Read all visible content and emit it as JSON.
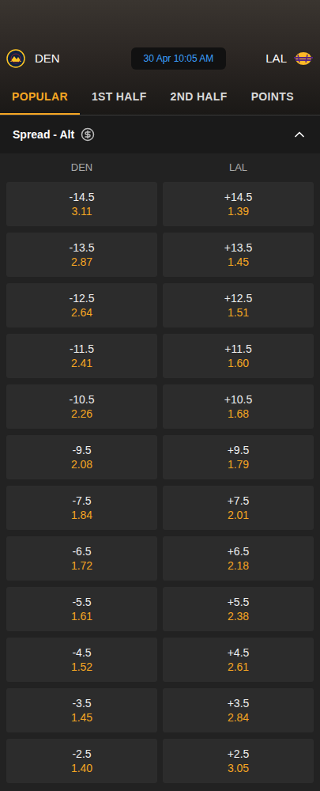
{
  "match": {
    "home": "DEN",
    "away": "LAL",
    "time": "30 Apr 10:05 AM"
  },
  "tabs": [
    {
      "label": "POPULAR",
      "selected": true
    },
    {
      "label": "1ST HALF",
      "selected": false
    },
    {
      "label": "2ND HALF",
      "selected": false
    },
    {
      "label": "POINTS",
      "selected": false
    }
  ],
  "market": {
    "title": "Spread - Alt",
    "expanded": true
  },
  "columns": [
    "DEN",
    "LAL"
  ],
  "rows": [
    {
      "cells": [
        {
          "line": "-14.5",
          "odds": "3.11"
        },
        {
          "line": "+14.5",
          "odds": "1.39"
        }
      ]
    },
    {
      "cells": [
        {
          "line": "-13.5",
          "odds": "2.87"
        },
        {
          "line": "+13.5",
          "odds": "1.45"
        }
      ]
    },
    {
      "cells": [
        {
          "line": "-12.5",
          "odds": "2.64"
        },
        {
          "line": "+12.5",
          "odds": "1.51"
        }
      ]
    },
    {
      "cells": [
        {
          "line": "-11.5",
          "odds": "2.41"
        },
        {
          "line": "+11.5",
          "odds": "1.60"
        }
      ]
    },
    {
      "cells": [
        {
          "line": "-10.5",
          "odds": "2.26"
        },
        {
          "line": "+10.5",
          "odds": "1.68"
        }
      ]
    },
    {
      "cells": [
        {
          "line": "-9.5",
          "odds": "2.08"
        },
        {
          "line": "+9.5",
          "odds": "1.79"
        }
      ]
    },
    {
      "cells": [
        {
          "line": "-7.5",
          "odds": "1.84"
        },
        {
          "line": "+7.5",
          "odds": "2.01"
        }
      ]
    },
    {
      "cells": [
        {
          "line": "-6.5",
          "odds": "1.72"
        },
        {
          "line": "+6.5",
          "odds": "2.18"
        }
      ]
    },
    {
      "cells": [
        {
          "line": "-5.5",
          "odds": "1.61"
        },
        {
          "line": "+5.5",
          "odds": "2.38"
        }
      ]
    },
    {
      "cells": [
        {
          "line": "-4.5",
          "odds": "1.52"
        },
        {
          "line": "+4.5",
          "odds": "2.61"
        }
      ]
    },
    {
      "cells": [
        {
          "line": "-3.5",
          "odds": "1.45"
        },
        {
          "line": "+3.5",
          "odds": "2.84"
        }
      ]
    },
    {
      "cells": [
        {
          "line": "-2.5",
          "odds": "1.40"
        },
        {
          "line": "+2.5",
          "odds": "3.05"
        }
      ]
    }
  ]
}
